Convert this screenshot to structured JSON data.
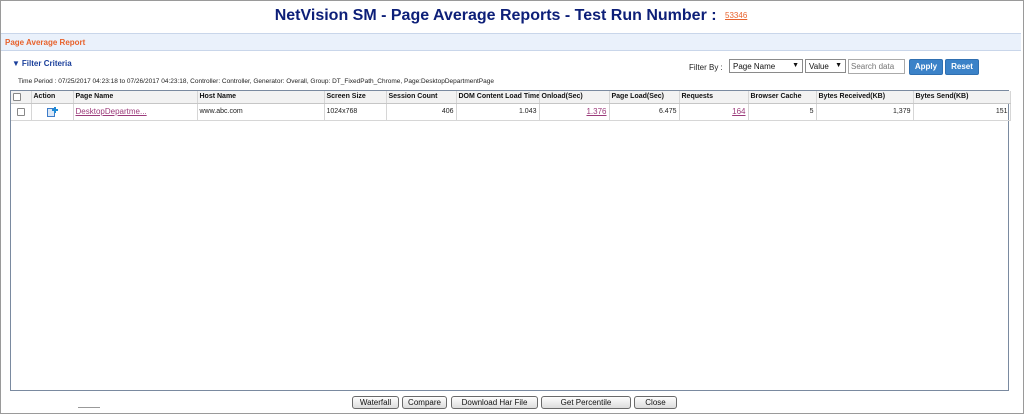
{
  "header": {
    "title": "NetVision SM - Page Average Reports - Test Run Number :",
    "run_number": "53346"
  },
  "section": {
    "title": "Page Average Report"
  },
  "filter": {
    "toggle_label": "Filter Criteria",
    "filter_by_label": "Filter By :",
    "filter_by_selected": "Page Name",
    "value_selected": "Value",
    "search_placeholder": "Search data",
    "apply_label": "Apply",
    "reset_label": "Reset",
    "time_period_text": "Time Period : 07/25/2017 04:23:18 to 07/26/2017 04:23:18, Controller: Controller, Generator: Overall, Group: DT_FixedPath_Chrome, Page:DesktopDepartmentPage"
  },
  "table": {
    "columns": [
      "",
      "Action",
      "Page Name",
      "Host Name",
      "Screen Size",
      "Session Count",
      "DOM Content Load Time",
      "Onload(Sec)",
      "Page Load(Sec)",
      "Requests",
      "Browser Cache",
      "Bytes Received(KB)",
      "Bytes Send(KB)"
    ],
    "rows": [
      {
        "page_name": "DesktopDepartme...",
        "host_name": "www.abc.com",
        "screen_size": "1024x768",
        "session_count": "406",
        "dom_content_load": "1.043",
        "onload": "1.376",
        "page_load": "6.475",
        "requests": "164",
        "browser_cache": "5",
        "bytes_received": "1,379",
        "bytes_send": "151"
      }
    ]
  },
  "footer": {
    "waterfall_label": "Waterfall",
    "compare_label": "Compare",
    "download_har_label": "Download Har File",
    "percentile_label": "Get Percentile",
    "close_label": "Close"
  },
  "icons": {
    "action_icon": "add-page-icon",
    "filter_toggle_icon": "triangle-down-icon"
  },
  "colors": {
    "title": "#0d1f78",
    "accent_orange": "#e8622c",
    "section_bg": "#eaf1fb",
    "button_blue": "#3b82c8",
    "link": "#9b3a7a"
  }
}
